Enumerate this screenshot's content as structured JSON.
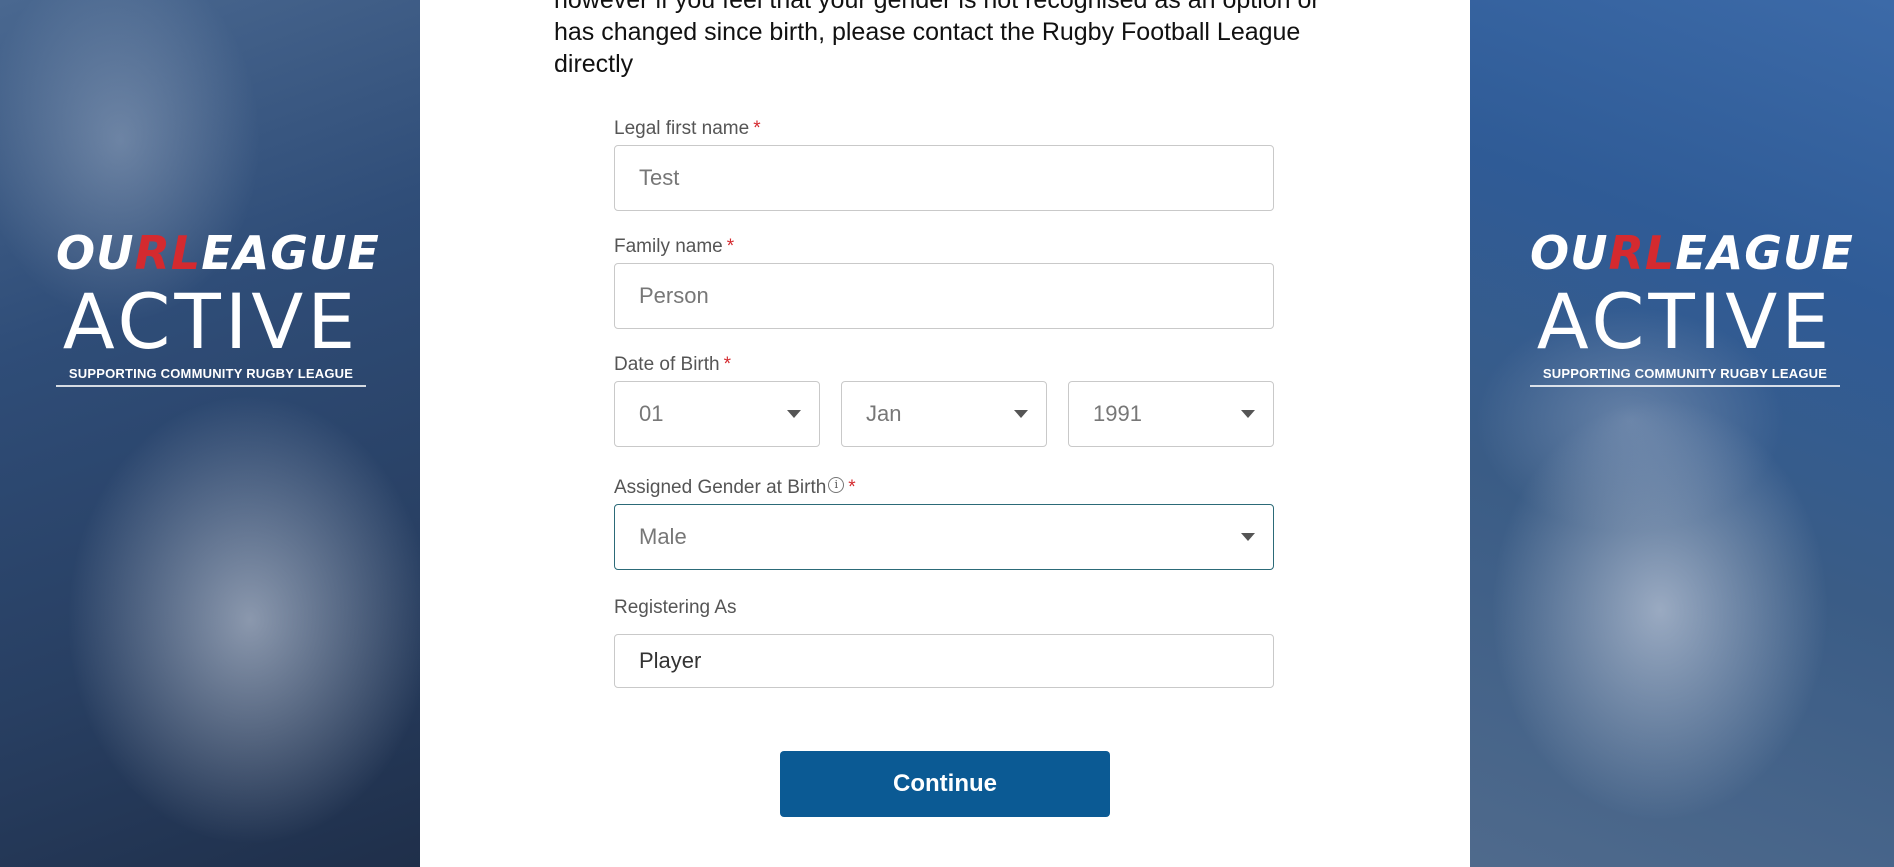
{
  "branding": {
    "logo_prefix": "OU",
    "logo_rl": "RL",
    "logo_suffix": "EAGUE",
    "logo_main": "ACTIVE",
    "logo_tagline": "SUPPORTING COMMUNITY RUGBY LEAGUE",
    "accent_color": "#d42a2f"
  },
  "notice": {
    "text": "however if you feel that your gender is not recognised as an option or has changed since birth, please contact the Rugby Football League directly"
  },
  "form": {
    "first_name": {
      "label": "Legal first name",
      "required_mark": "*",
      "value": "Test"
    },
    "family_name": {
      "label": "Family name",
      "required_mark": "*",
      "value": "Person"
    },
    "dob": {
      "label": "Date of Birth",
      "required_mark": "*",
      "day": "01",
      "month": "Jan",
      "year": "1991"
    },
    "gender": {
      "label": "Assigned Gender at Birth",
      "info_icon": "info-icon",
      "info_glyph": "i",
      "required_mark": "*",
      "value": "Male"
    },
    "registering_as": {
      "label": "Registering As",
      "value": "Player"
    },
    "continue_label": "Continue",
    "button_color": "#0b5a94"
  }
}
